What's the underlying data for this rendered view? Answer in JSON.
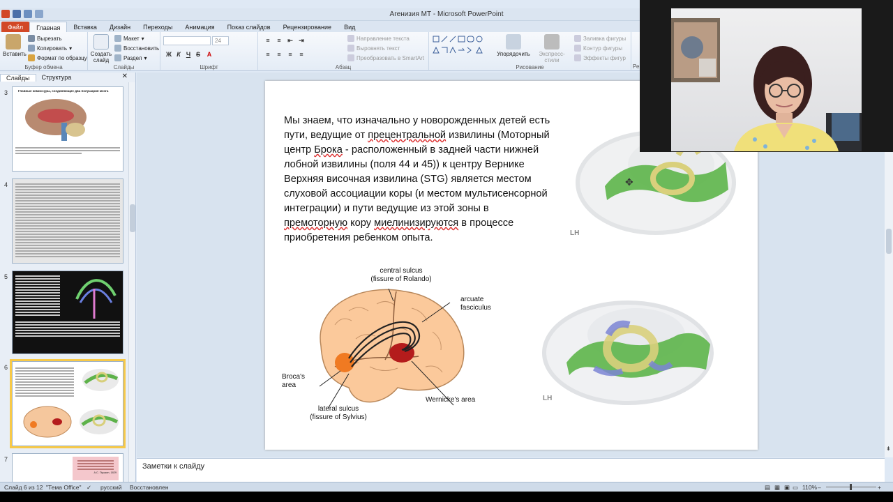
{
  "window": {
    "title": "Агенизия МТ - Microsoft PowerPoint"
  },
  "tabs": [
    "Файл",
    "Главная",
    "Вставка",
    "Дизайн",
    "Переходы",
    "Анимация",
    "Показ слайдов",
    "Рецензирование",
    "Вид"
  ],
  "ribbon": {
    "clipboard": {
      "label": "Буфер обмена",
      "paste": "Вставить",
      "cut": "Вырезать",
      "copy": "Копировать",
      "format_painter": "Формат по образцу"
    },
    "slides": {
      "label": "Слайды",
      "new_slide": "Создать слайд",
      "layout": "Макет",
      "reset": "Восстановить",
      "section": "Раздел"
    },
    "font": {
      "label": "Шрифт",
      "size": "24"
    },
    "paragraph": {
      "label": "Абзац",
      "text_direction": "Направление текста",
      "align_text": "Выровнять текст",
      "smartart": "Преобразовать в SmartArt"
    },
    "drawing": {
      "label": "Рисование",
      "arrange": "Упорядочить",
      "quick_styles": "Экспресс-стили",
      "fill": "Заливка фигуры",
      "outline": "Контур фигуры",
      "effects": "Эффекты фигур",
      "cut_label": "Ре"
    }
  },
  "pane_tabs": {
    "slides": "Слайды",
    "outline": "Структура"
  },
  "thumbnails": [
    {
      "num": "3",
      "title": "Главные комиссуры, соединяющие два полушария мозга"
    },
    {
      "num": "4"
    },
    {
      "num": "5"
    },
    {
      "num": "6"
    },
    {
      "num": "7",
      "caption": "А.С. Пушкин, 1829"
    }
  ],
  "slide": {
    "paragraph1_parts": [
      "Мы знаем, что изначально  у новорожденных детей есть пути, ведущие от ",
      "прецентральной",
      " извилины (Моторный центр ",
      "Брока",
      " - расположенный в задней части нижней лобной извилины (поля 44 и 45)) к центру Вернике"
    ],
    "paragraph2_parts": [
      "Верхняя височная извилина (STG) является местом слуховой ассоциации коры (и местом мультисенсорной интеграции) и пути ведущие из этой зоны в ",
      "премоторную",
      " кору ",
      "миелинизируются",
      " в процессе приобретения ребенком опыта."
    ],
    "diagram": {
      "central_sulcus": "central sulcus",
      "central_sulcus_sub": "(fissure of Rolando)",
      "arcuate": "arcuate",
      "arcuate_sub": "fasciculus",
      "broca": "Broca's",
      "broca_sub": "area",
      "lateral": "lateral sulcus",
      "lateral_sub": "(fissure of Sylvius)",
      "wernicke": "Wernicke's area"
    },
    "lh_top": "LH",
    "lh_bottom": "LH"
  },
  "notes": {
    "placeholder": "Заметки к слайду"
  },
  "status": {
    "slide_count": "Слайд 6 из 12",
    "theme": "\"Тема Office\"",
    "language": "русский",
    "restored": "Восстановлен",
    "zoom": "110%"
  }
}
